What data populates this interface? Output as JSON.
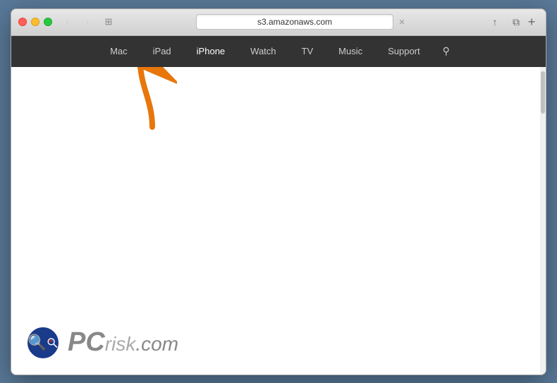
{
  "browser": {
    "title": "s3.amazonaws.com",
    "url": "s3.amazonaws.com",
    "traffic_lights": {
      "close": "close",
      "minimize": "minimize",
      "maximize": "maximize"
    },
    "nav_back_label": "‹",
    "nav_forward_label": "›",
    "reader_label": "⊞",
    "address_close_label": "✕",
    "share_label": "↑",
    "duplicate_label": "⧉",
    "new_tab_label": "+"
  },
  "apple_nav": {
    "items": [
      {
        "id": "mac",
        "label": "Mac"
      },
      {
        "id": "ipad",
        "label": "iPad"
      },
      {
        "id": "iphone",
        "label": "iPhone"
      },
      {
        "id": "watch",
        "label": "Watch"
      },
      {
        "id": "tv",
        "label": "TV"
      },
      {
        "id": "music",
        "label": "Music"
      },
      {
        "id": "support",
        "label": "Support"
      }
    ],
    "search_icon": "🔍"
  },
  "watermark": {
    "pc_text": "PC",
    "risk_text": "risk",
    "dot_com_text": ".com"
  }
}
